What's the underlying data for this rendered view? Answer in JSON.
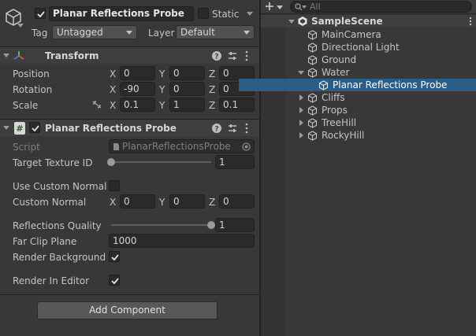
{
  "inspector": {
    "object_name": "Planar Reflections Probe",
    "static_label": "Static",
    "tag_label": "Tag",
    "tag_value": "Untagged",
    "layer_label": "Layer",
    "layer_value": "Default"
  },
  "transform": {
    "title": "Transform",
    "position_label": "Position",
    "rotation_label": "Rotation",
    "scale_label": "Scale",
    "position": {
      "x": "0",
      "y": "0",
      "z": "0"
    },
    "rotation": {
      "x": "-90",
      "y": "0",
      "z": "0"
    },
    "scale": {
      "x": "0.1",
      "y": "1",
      "z": "0.1"
    }
  },
  "axes": {
    "x": "X",
    "y": "Y",
    "z": "Z"
  },
  "probe": {
    "title": "Planar Reflections Probe",
    "script_label": "Script",
    "script_value": "PlanarReflectionsProbe",
    "target_texture_id_label": "Target Texture ID",
    "target_texture_id_value": "1",
    "target_texture_id_fraction": 0,
    "use_custom_normal_label": "Use Custom Normal",
    "use_custom_normal": false,
    "custom_normal_label": "Custom Normal",
    "custom_normal": {
      "x": "0",
      "y": "0",
      "z": "0"
    },
    "reflections_quality_label": "Reflections Quality",
    "reflections_quality_value": "1",
    "reflections_quality_fraction": 1,
    "far_clip_plane_label": "Far Clip Plane",
    "far_clip_plane_value": "1000",
    "render_background_label": "Render Background",
    "render_background": true,
    "render_in_editor_label": "Render In Editor",
    "render_in_editor": true
  },
  "add_component_label": "Add Component",
  "hierarchy": {
    "search_placeholder": "All",
    "scene_name": "SampleScene",
    "items": [
      {
        "label": "MainCamera"
      },
      {
        "label": "Directional Light"
      },
      {
        "label": "Ground"
      },
      {
        "label": "Water"
      },
      {
        "label": "Planar Reflections Probe"
      },
      {
        "label": "Cliffs"
      },
      {
        "label": "Props"
      },
      {
        "label": "TreeHill"
      },
      {
        "label": "RockyHill"
      }
    ]
  },
  "colors": {
    "background": "#383838",
    "selection": "#2c5d87",
    "field": "#2a2a2a"
  }
}
